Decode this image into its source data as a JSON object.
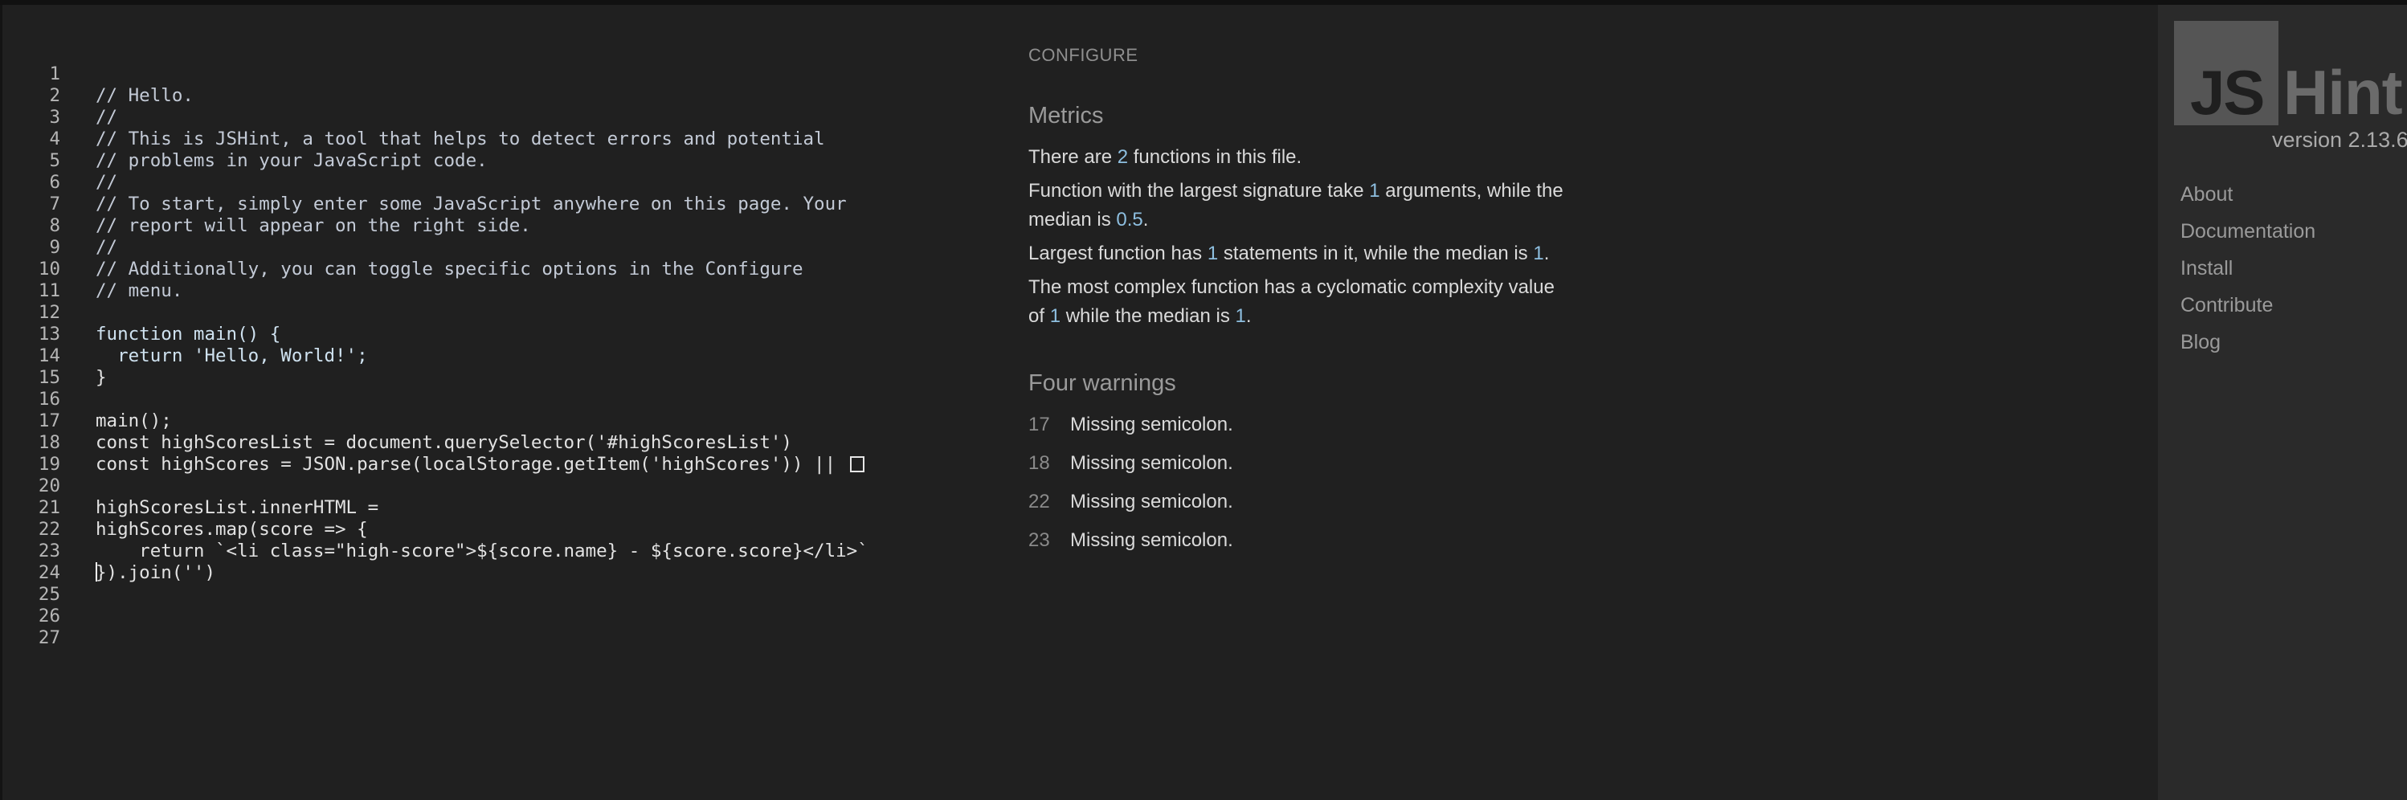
{
  "editor": {
    "lines": [
      {
        "n": "1",
        "t": "// Hello."
      },
      {
        "n": "2",
        "t": "//"
      },
      {
        "n": "3",
        "t": "// This is JSHint, a tool that helps to detect errors and potential"
      },
      {
        "n": "4",
        "t": "// problems in your JavaScript code."
      },
      {
        "n": "5",
        "t": "//"
      },
      {
        "n": "6",
        "t": "// To start, simply enter some JavaScript anywhere on this page. Your"
      },
      {
        "n": "7",
        "t": "// report will appear on the right side."
      },
      {
        "n": "8",
        "t": "//"
      },
      {
        "n": "9",
        "t": "// Additionally, you can toggle specific options in the Configure"
      },
      {
        "n": "10",
        "t": "// menu."
      },
      {
        "n": "11",
        "t": ""
      },
      {
        "n": "12",
        "t": "function main() {"
      },
      {
        "n": "13",
        "t": "  return 'Hello, World!';"
      },
      {
        "n": "14",
        "t": "}"
      },
      {
        "n": "15",
        "t": ""
      },
      {
        "n": "16",
        "t": "main();"
      },
      {
        "n": "17",
        "t": "const highScoresList = document.querySelector('#highScoresList')"
      },
      {
        "n": "18",
        "t": "const highScores = JSON.parse(localStorage.getItem('highScores')) || "
      },
      {
        "n": "19",
        "t": ""
      },
      {
        "n": "20",
        "t": "highScoresList.innerHTML ="
      },
      {
        "n": "21",
        "t": "highScores.map(score => {"
      },
      {
        "n": "22",
        "t": "    return `<li class=\"high-score\">${score.name} - ${score.score}</li>`"
      },
      {
        "n": "23",
        "t": "}).join('')"
      },
      {
        "n": "24",
        "t": ""
      },
      {
        "n": "25",
        "t": ""
      },
      {
        "n": "26",
        "t": ""
      },
      {
        "n": "27",
        "t": ""
      }
    ]
  },
  "report": {
    "configure_label": "CONFIGURE",
    "metrics_title": "Metrics",
    "metric1": {
      "a": "There are ",
      "v": "2",
      "b": " functions in this file."
    },
    "metric2": {
      "a": "Function with the largest signature take ",
      "v": "1",
      "b": " arguments, while the",
      "c": "median is ",
      "v2": "0.5",
      "d": "."
    },
    "metric3": {
      "a": "Largest function has ",
      "v": "1",
      "b": " statements in it, while the median is ",
      "v2": "1",
      "c": "."
    },
    "metric4": {
      "a": "The most complex function has a cyclomatic complexity value",
      "b": "of ",
      "v": "1",
      "c": " while the median is ",
      "v2": "1",
      "d": "."
    },
    "warnings_title": "Four warnings",
    "warnings": [
      {
        "line": "17",
        "msg": "Missing semicolon."
      },
      {
        "line": "18",
        "msg": "Missing semicolon."
      },
      {
        "line": "22",
        "msg": "Missing semicolon."
      },
      {
        "line": "23",
        "msg": "Missing semicolon."
      }
    ]
  },
  "sidebar": {
    "logo_js": "JS",
    "logo_hint": "Hint",
    "version": "version 2.13.6",
    "nav": [
      "About",
      "Documentation",
      "Install",
      "Contribute",
      "Blog"
    ]
  },
  "colors": {
    "background": "#202020",
    "sidebar": "#2a2a2a",
    "highlight": "#8ebfe0"
  }
}
